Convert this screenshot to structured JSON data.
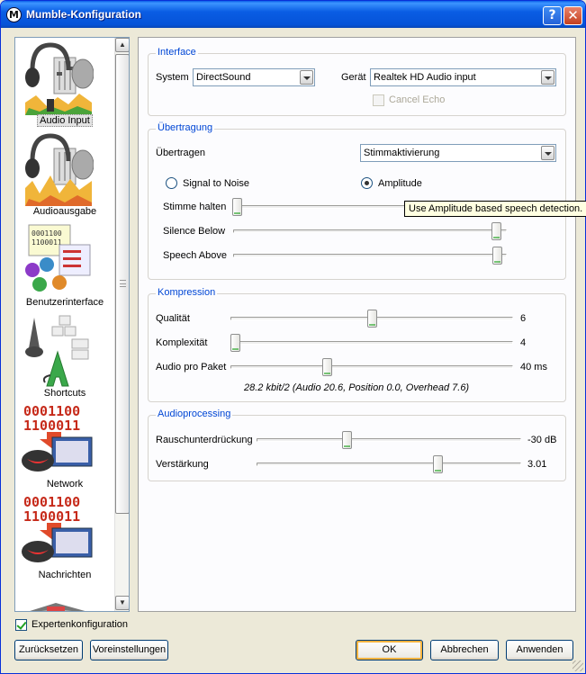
{
  "window": {
    "title": "Mumble-Konfiguration",
    "app_icon_glyph": "M",
    "help_glyph": "?",
    "close_glyph": "✕"
  },
  "colors": {
    "titlebar": "#0A5DE4",
    "group_title": "#0046D5",
    "accent_check": "#21A121"
  },
  "nav": {
    "items": [
      {
        "label": "Audio Input",
        "icon": "microphone-headset-icon",
        "selected": true
      },
      {
        "label": "Audioausgabe",
        "icon": "headset-speaker-icon",
        "selected": false
      },
      {
        "label": "Benutzerinterface",
        "icon": "user-interface-icon",
        "selected": false
      },
      {
        "label": "Shortcuts",
        "icon": "keyboard-shortcut-icon",
        "selected": false
      },
      {
        "label": "Network",
        "icon": "network-binary-icon",
        "selected": false
      },
      {
        "label": "Nachrichten",
        "icon": "messages-binary-icon",
        "selected": false
      }
    ],
    "scroll_up": "▲",
    "scroll_down": "▼"
  },
  "interface": {
    "title": "Interface",
    "system_label": "System",
    "system_value": "DirectSound",
    "device_label": "Gerät",
    "device_value": "Realtek HD Audio input",
    "cancel_echo_label": "Cancel Echo",
    "cancel_echo_checked": false,
    "cancel_echo_enabled": false
  },
  "transmission": {
    "title": "Übertragung",
    "transmit_label": "Übertragen",
    "transmit_value": "Stimmaktivierung",
    "radio_snr_label": "Signal to Noise",
    "radio_amplitude_label": "Amplitude",
    "selected_mode": "Amplitude",
    "hold_label": "Stimme halten",
    "silence_label": "Silence Below",
    "speech_label": "Speech Above",
    "tooltip": "Use Amplitude based speech detection."
  },
  "compression": {
    "title": "Kompression",
    "quality_label": "Qualität",
    "quality_value": "6",
    "complexity_label": "Komplexität",
    "complexity_value": "4",
    "audio_per_packet_label": "Audio pro Paket",
    "audio_per_packet_value": "40 ms",
    "bitrate_text": "28.2 kbit/2 (Audio 20.6, Position 0.0, Overhead 7.6)"
  },
  "audioprocessing": {
    "title": "Audioprocessing",
    "noise_label": "Rauschunterdrückung",
    "noise_value": "-30 dB",
    "amplification_label": "Verstärkung",
    "amplification_value": "3.01"
  },
  "footer": {
    "expert_label": "Expertenkonfiguration",
    "expert_checked": true,
    "reset_button": "Zurücksetzen",
    "defaults_button": "Voreinstellungen",
    "ok_button": "OK",
    "cancel_button": "Abbrechen",
    "apply_button": "Anwenden"
  }
}
